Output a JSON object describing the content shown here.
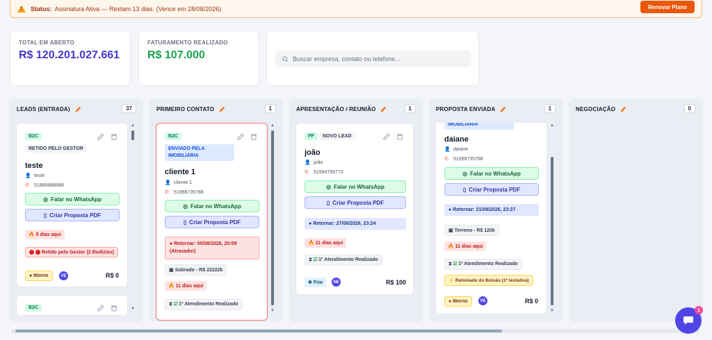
{
  "banner": {
    "status_label": "Status:",
    "message": "Assinatura Ativa — Restam 13 dias. (Vence em 28/08/2026)",
    "renew": "Renovar Plano"
  },
  "stats": {
    "open_label": "TOTAL EM ABERTO",
    "open_value": "R$ 120.201.027.661",
    "billed_label": "FATURAMENTO REALIZADO",
    "billed_value": "R$ 107.000"
  },
  "search": {
    "placeholder": "Buscar empresa, contato ou telefone..."
  },
  "colors": {
    "accent": "#4f46e5",
    "billed": "#16a34a",
    "open": "#4338ca",
    "warning": "#ea580c"
  },
  "columns": [
    {
      "title": "LEADS (ENTRADA)",
      "count": "37"
    },
    {
      "title": "PRIMEIRO CONTATO",
      "count": "1"
    },
    {
      "title": "APRESENTAÇÃO / REUNIÃO",
      "count": "1"
    },
    {
      "title": "PROPOSTA ENVIADA",
      "count": "1"
    },
    {
      "title": "NEGOCIAÇÃO",
      "count": "0"
    }
  ],
  "common": {
    "whatsapp": "Falar no WhatsApp",
    "pdf": "Criar Proposta PDF"
  },
  "cards": {
    "c1": {
      "type": "B2C",
      "status": "RETIDO PELO GESTOR",
      "name": "teste",
      "contact": "teste",
      "phone": "51888888888",
      "days": "5 dias aqui",
      "retido": "Retido pelo Gestor (2 Rodízios)",
      "temp": "Morno",
      "avatar": "VE",
      "price": "R$ 0"
    },
    "c1b": {
      "type": "B2C"
    },
    "c2": {
      "type": "B2C",
      "status": "ENVIADO PELA IMOBILIÁRIA",
      "name": "cliente 1",
      "contact": "cliente 1",
      "phone": "51998735788",
      "return": "Retornar: 05/08/2026, 20:09 (Atrasado!)",
      "property": "Sobrado - R$ 22222k",
      "days": "11 dias aqui",
      "step": "1º Atendimento Realizado"
    },
    "c3": {
      "type": "PF",
      "status": "NOVO LEAD",
      "name": "joão",
      "contact": "joão",
      "phone": "51994790773",
      "return": "Retornar: 27/08/2026, 23:24",
      "days": "11 dias aqui",
      "step": "1º Atendimento Realizado",
      "temp": "Frio",
      "avatar": "NE",
      "price": "R$ 100"
    },
    "c4": {
      "status": "IMOBILIÁRIA",
      "name": "daiane",
      "contact": "daiane",
      "phone": "51998735788",
      "return": "Retornar: 21/08/2026, 23:27",
      "property": "Terreno - R$ 120k",
      "days": "11 dias aqui",
      "step": "1º Atendimento Realizado",
      "bolsao": "Retomado do Bolsão (1ª tentativa)",
      "temp": "Morno",
      "avatar": "VE",
      "price": "R$ 0"
    }
  },
  "chat": {
    "badge": "1"
  }
}
